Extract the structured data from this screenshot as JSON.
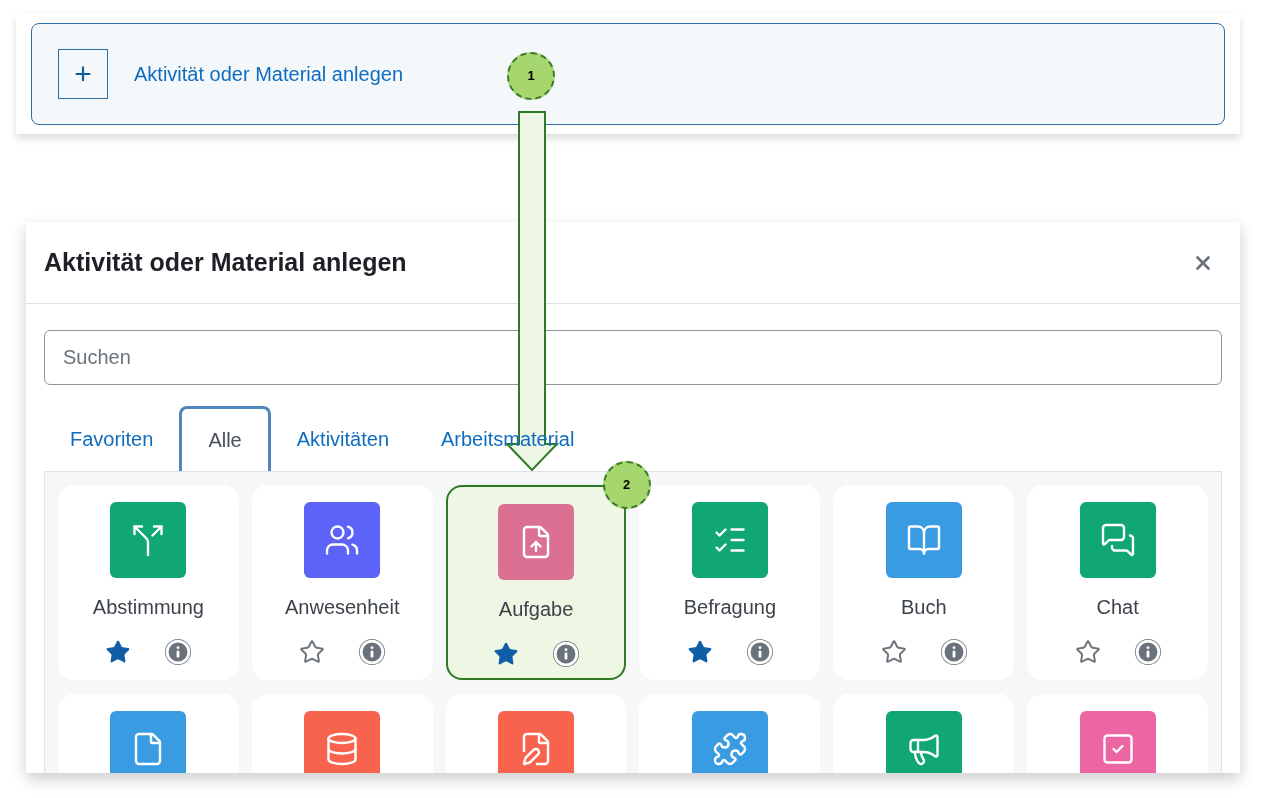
{
  "trigger": {
    "label": "Aktivität oder Material anlegen",
    "icon": "+"
  },
  "callouts": [
    "1",
    "2"
  ],
  "dialog": {
    "title": "Aktivität oder Material anlegen",
    "search": {
      "placeholder": "Suchen"
    },
    "tabs": [
      {
        "label": "Favoriten",
        "selected": false
      },
      {
        "label": "Alle",
        "selected": true
      },
      {
        "label": "Aktivitäten",
        "selected": false
      },
      {
        "label": "Arbeitsmaterial",
        "selected": false
      }
    ],
    "items": [
      {
        "name": "Abstimmung",
        "kind": "choice",
        "color": "#11a676",
        "favorite": true,
        "highlighted": false
      },
      {
        "name": "Anwesenheit",
        "kind": "attendance",
        "color": "#5d63f6",
        "favorite": false,
        "highlighted": false
      },
      {
        "name": "Aufgabe",
        "kind": "assign",
        "color": "#db7093",
        "favorite": true,
        "highlighted": true
      },
      {
        "name": "Befragung",
        "kind": "feedback",
        "color": "#11a676",
        "favorite": true,
        "highlighted": false
      },
      {
        "name": "Buch",
        "kind": "book",
        "color": "#399be2",
        "favorite": false,
        "highlighted": false
      },
      {
        "name": "Chat",
        "kind": "chat",
        "color": "#11a676",
        "favorite": false,
        "highlighted": false
      },
      {
        "kind": "file",
        "color": "#399be2"
      },
      {
        "kind": "database",
        "color": "#f7634d"
      },
      {
        "kind": "exam",
        "color": "#f7634d"
      },
      {
        "kind": "puzzle",
        "color": "#399be2"
      },
      {
        "kind": "megaphone",
        "color": "#11a676"
      },
      {
        "kind": "checklist",
        "color": "#eb66a2"
      }
    ]
  }
}
